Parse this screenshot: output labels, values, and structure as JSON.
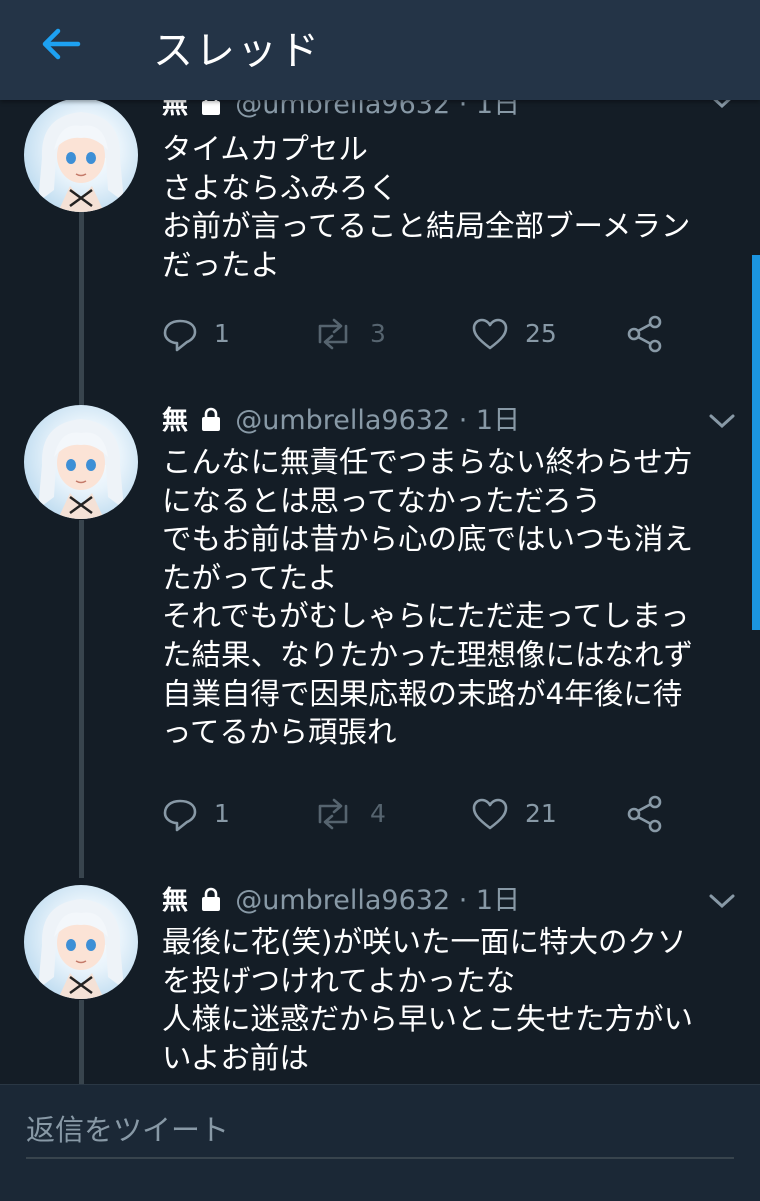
{
  "header": {
    "title": "スレッド",
    "back_icon": "arrow-left-icon",
    "accent_color": "#1da1f2"
  },
  "tweets": [
    {
      "name": "無",
      "handle": "@umbrella9632",
      "separator": "·",
      "time": "1日",
      "lines": [
        "タイムカプセル",
        "さよならふみろく",
        "お前が言ってること結局全部ブーメラン",
        "だったよ"
      ],
      "replies": "1",
      "retweets": "3",
      "likes": "25"
    },
    {
      "name": "無",
      "handle": "@umbrella9632",
      "separator": "·",
      "time": "1日",
      "lines": [
        "こんなに無責任でつまらない終わらせ方",
        "になるとは思ってなかっただろう",
        "でもお前は昔から心の底ではいつも消え",
        "たがってたよ",
        "それでもがむしゃらにただ走ってしまっ",
        "た結果、なりたかった理想像にはなれず",
        "自業自得で因果応報の末路が4年後に待",
        "ってるから頑張れ"
      ],
      "replies": "1",
      "retweets": "4",
      "likes": "21"
    },
    {
      "name": "無",
      "handle": "@umbrella9632",
      "separator": "·",
      "time": "1日",
      "lines": [
        "最後に花(笑)が咲いた一面に特大のクソ",
        "を投げつけれてよかったな",
        "人様に迷惑だから早いとこ失せた方がい",
        "いよお前は"
      ]
    }
  ],
  "composer": {
    "placeholder": "返信をツイート"
  }
}
